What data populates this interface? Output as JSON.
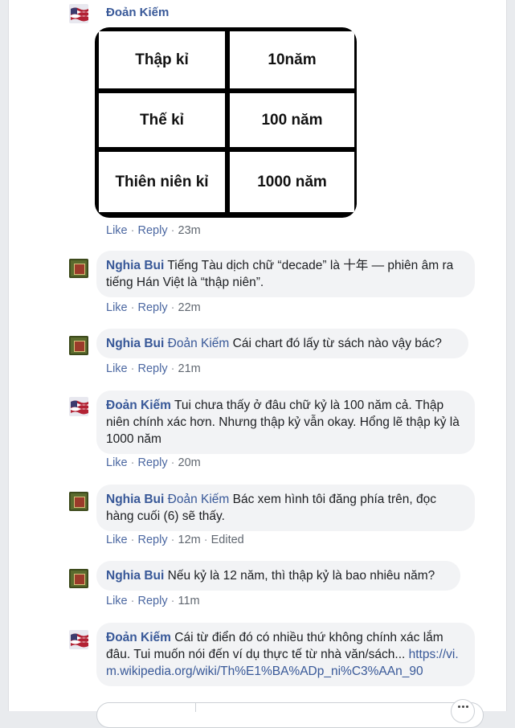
{
  "sep": "·",
  "post": {
    "author": "Đoản Kiếm",
    "image_table": [
      [
        "Thập kỉ",
        "10năm"
      ],
      [
        "Thế kỉ",
        "100 năm"
      ],
      [
        "Thiên niên kỉ",
        "1000 năm"
      ]
    ],
    "actions": {
      "like": "Like",
      "reply": "Reply",
      "time": "23m"
    }
  },
  "comments": [
    {
      "author": "Nghia Bui",
      "mention": "",
      "text": "Tiếng Tàu dịch chữ “decade” là 十年 — phiên âm ra tiếng Hán Việt là “thập niên”.",
      "like": "Like",
      "reply": "Reply",
      "time": "22m"
    },
    {
      "author": "Nghia Bui",
      "mention": "Đoản Kiếm",
      "text": "Cái chart đó lấy từ sách nào vậy bác?",
      "like": "Like",
      "reply": "Reply",
      "time": "21m"
    },
    {
      "author": "Đoản Kiếm",
      "mention": "",
      "text": "Tui chưa thấy ở đâu chữ kỷ là 100 năm cả. Thập niên chính xác hơn. Nhưng thập kỷ vẫn okay. Hổng lẽ thập kỷ là 1000 năm",
      "like": "Like",
      "reply": "Reply",
      "time": "20m"
    },
    {
      "author": "Nghia Bui",
      "mention": "Đoản Kiếm",
      "text": "Bác xem hình tôi đăng phía trên, đọc hàng cuối (6) sẽ thấy.",
      "like": "Like",
      "reply": "Reply",
      "time": "12m",
      "edited": "Edited"
    },
    {
      "author": "Nghia Bui",
      "mention": "",
      "text": "Nếu kỷ là 12 năm, thì thập kỷ là bao nhiêu năm?",
      "like": "Like",
      "reply": "Reply",
      "time": "11m"
    },
    {
      "author": "Đoản Kiếm",
      "mention": "",
      "text": "Cái từ điển đó có nhiều thứ không chính xác lắm đâu. Tui muốn nói đến ví dụ thực tế từ nhà văn/sách...",
      "link": "https://vi.m.wikipedia.org/wiki/Th%E1%BA%ADp_ni%C3%AAn_90"
    }
  ]
}
